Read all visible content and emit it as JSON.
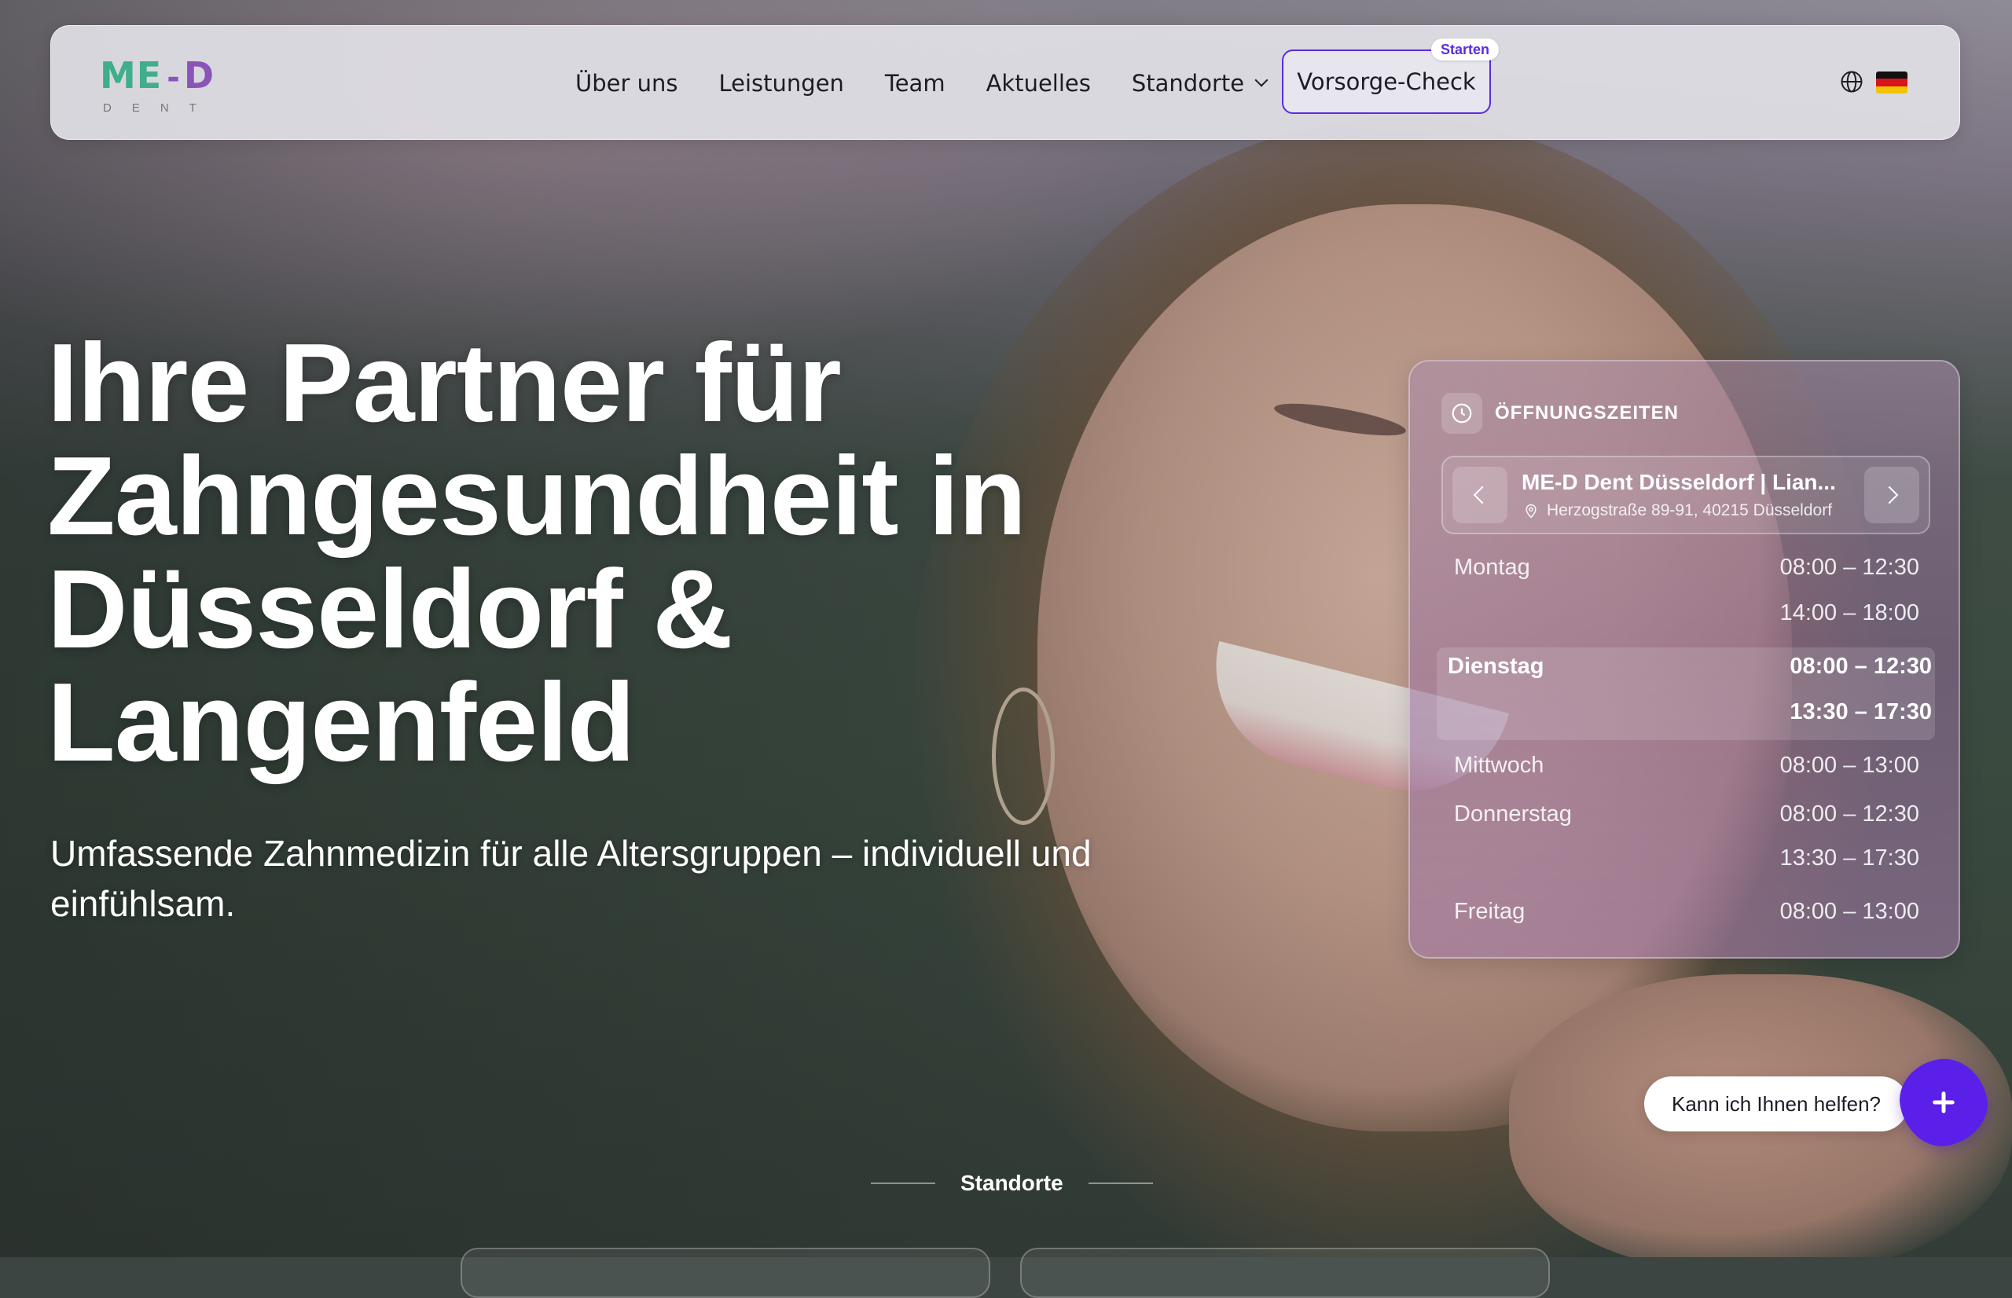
{
  "brand": {
    "logo_main_left": "ME",
    "logo_main_dash": "-",
    "logo_main_right": "D",
    "logo_sub": "DENT",
    "colors": {
      "green": "#3fae8a",
      "purple": "#8b54b8",
      "accent": "#5b2be0"
    }
  },
  "nav": {
    "items": [
      {
        "label": "Über uns"
      },
      {
        "label": "Leistungen"
      },
      {
        "label": "Team"
      },
      {
        "label": "Aktuelles"
      },
      {
        "label": "Standorte"
      }
    ],
    "cta_label": "Vorsorge-Check",
    "cta_badge": "Starten",
    "language_icon": "globe-icon",
    "flag": "de-flag"
  },
  "hero": {
    "title": "Ihre Partner für Zahngesundheit in Düsseldorf & Langenfeld",
    "subtitle": "Umfassende Zahnmedizin für alle Altersgruppen – individuell und einfühlsam."
  },
  "hours": {
    "title": "ÖFFNUNGSZEITEN",
    "location_name": "ME-D Dent Düsseldorf | Lian...",
    "location_address": "Herzogstraße 89-91, 40215 Düsseldorf",
    "days": [
      {
        "day": "Montag",
        "times": [
          "08:00 – 12:30",
          "14:00 – 18:00"
        ]
      },
      {
        "day": "Dienstag",
        "times": [
          "08:00 – 12:30",
          "13:30 – 17:30"
        ],
        "today": true
      },
      {
        "day": "Mittwoch",
        "times": [
          "08:00 – 13:00"
        ]
      },
      {
        "day": "Donnerstag",
        "times": [
          "08:00 – 12:30",
          "13:30 – 17:30"
        ]
      },
      {
        "day": "Freitag",
        "times": [
          "08:00 – 13:00"
        ]
      }
    ]
  },
  "chat": {
    "prompt": "Kann ich Ihnen helfen?"
  },
  "sections": {
    "locations_label": "Standorte"
  }
}
